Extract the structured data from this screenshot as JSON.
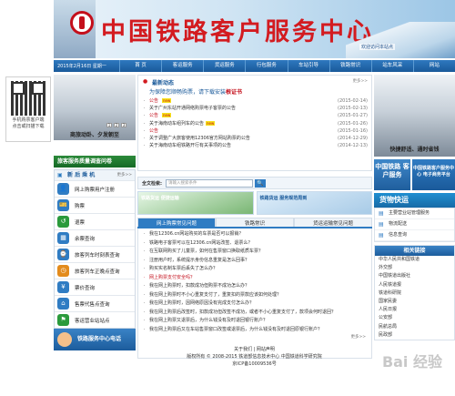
{
  "site": {
    "title": "中国铁路客户服务中心",
    "title_color": "#d31b20",
    "banner_hint": "欢迎访问本站点"
  },
  "qr_box": {
    "line1": "手机购票客户端",
    "line2": "点击或扫描下载"
  },
  "nav": {
    "date": "2015年2月16日 星期一",
    "items": [
      "首  页",
      "客运服务",
      "货运服务",
      "行包服务",
      "车站引导",
      "铁路常识",
      "站车风采",
      "网站"
    ]
  },
  "left": {
    "photo_caption": "商旅动卧、夕发朝至",
    "photo_pages": [
      "1",
      "2",
      "3"
    ],
    "survey_label": "旅客服务质量调查问卷",
    "guide": {
      "title": "新 后 乘 机",
      "more": "更多>>",
      "items": [
        {
          "label": "网上购票用户注册",
          "icon": "user-register-icon",
          "color": "#2f7cc3"
        },
        {
          "label": "购票",
          "icon": "ticket-icon",
          "color": "#2f7cc3"
        },
        {
          "label": "退票",
          "icon": "refund-icon",
          "color": "#2a9a3c"
        },
        {
          "label": "余票查询",
          "icon": "remaining-ticket-icon",
          "color": "#2f7cc3"
        },
        {
          "label": "旅客列车时刻表查询",
          "icon": "timetable-icon",
          "color": "#2f7cc3"
        },
        {
          "label": "旅客列车正晚点查询",
          "icon": "clock-icon",
          "color": "#e38b1c"
        },
        {
          "label": "票价查询",
          "icon": "fare-icon",
          "color": "#2f7cc3"
        },
        {
          "label": "售票代售点查询",
          "icon": "agency-icon",
          "color": "#2f7cc3"
        },
        {
          "label": "客运营业站站点",
          "icon": "station-icon",
          "color": "#2a9a3c"
        }
      ]
    },
    "hotline": "铁路服务中心电话"
  },
  "center": {
    "news": {
      "title": "最新动态",
      "more": "更多>>",
      "notice": "为保障您顺畅购票，请下载安装",
      "notice_link": "根证书",
      "items": [
        {
          "ann": "公告",
          "text": "",
          "date": "(2015-02-14)",
          "new": true
        },
        {
          "ann": "",
          "text": "关于广州东站开通网络购票电子客票的公告",
          "date": "(2015-02-13)",
          "new": false
        },
        {
          "ann": "公告",
          "text": "",
          "date": "(2015-01-27)",
          "new": true
        },
        {
          "ann": "",
          "text": "关于海南动车组列车的公告",
          "date": "(2015-01-26)",
          "new": true
        },
        {
          "ann": "公告",
          "text": "",
          "date": "(2015-01-16)",
          "new": false
        },
        {
          "ann": "",
          "text": "关于调整广大旅客使用12306官方网站购票的公告",
          "date": "(2014-12-29)",
          "new": false
        },
        {
          "ann": "",
          "text": "关于海南动车组铁路开行有关事项的公告",
          "date": "(2014-12-13)",
          "new": false
        }
      ]
    },
    "search": {
      "label": "全文检索:",
      "placeholder": "请输入搜索条件",
      "button": "🔍"
    },
    "promos": [
      "铁路货运 便捷运输",
      "铁路货运 服务规范周到"
    ],
    "tabs": [
      "网上购票常见问题",
      "铁路常识",
      "货运运输常见问题"
    ],
    "active_tab": 0,
    "faq": [
      {
        "text": "我在12306.cn网站购买的车票是否可以报销？",
        "hl": false
      },
      {
        "text": "铁路电子客票可以在12306.cn网站改签、退票么？",
        "hl": false
      },
      {
        "text": "在互联网购买了儿童票，如何在售票窗口换取纸质车票？",
        "hl": false
      },
      {
        "text": "注册用户时，系统提示身份信息重复是怎么回事？",
        "hl": false
      },
      {
        "text": "购买实名制车票后丢失了怎么办？",
        "hl": false
      },
      {
        "text": "网上购票支付安全吗？",
        "hl": true
      },
      {
        "text": "我在网上购票时，扣款成功但购票不成功怎么办？",
        "hl": false
      },
      {
        "text": "我在网上购票时不小心重复支付了，重复扣的票款应该如何处理？",
        "hl": false
      },
      {
        "text": "我在网上购票时，因网络原因没有完成支付怎么办？",
        "hl": false
      },
      {
        "text": "我在网上购票后改签时，扣款成功但改签不成功，或者不小心重复支付了，款项会何时退回？",
        "hl": false
      },
      {
        "text": "我在网上购票又退票后，为什么钱没有及时退回银行账户？",
        "hl": false
      },
      {
        "text": "我在网上购票后又在车站售票窗口改签或退票后，为什么钱没有及时退回原银行账户？",
        "hl": false
      }
    ],
    "faq_more": "更多>>"
  },
  "right": {
    "photo_caption": "快捷舒适、通时省钱",
    "ad1": "中国铁路 客户服务",
    "ad2": "中国铁路客户服务中心 电子商务平台",
    "express": "货物快运",
    "services": [
      "主要营业站管理服务",
      "物流配送",
      "信息查询"
    ],
    "links_title": "相关链接",
    "links": [
      "中华人民共和国铁道",
      "外交部",
      "中国铁道出版社",
      "人民铁道报",
      "铁道科研院",
      "国家民委",
      "人民日报",
      "公安部",
      "民航总局",
      "民政部"
    ]
  },
  "footer": {
    "line1": "关于我们 | 网站声明",
    "line2": "版权所有 © 2008-2015 铁道部信息技术中心 中国铁道科学研究院",
    "line3": "京ICP备10009536号",
    "watermark": "Bai 经验"
  }
}
